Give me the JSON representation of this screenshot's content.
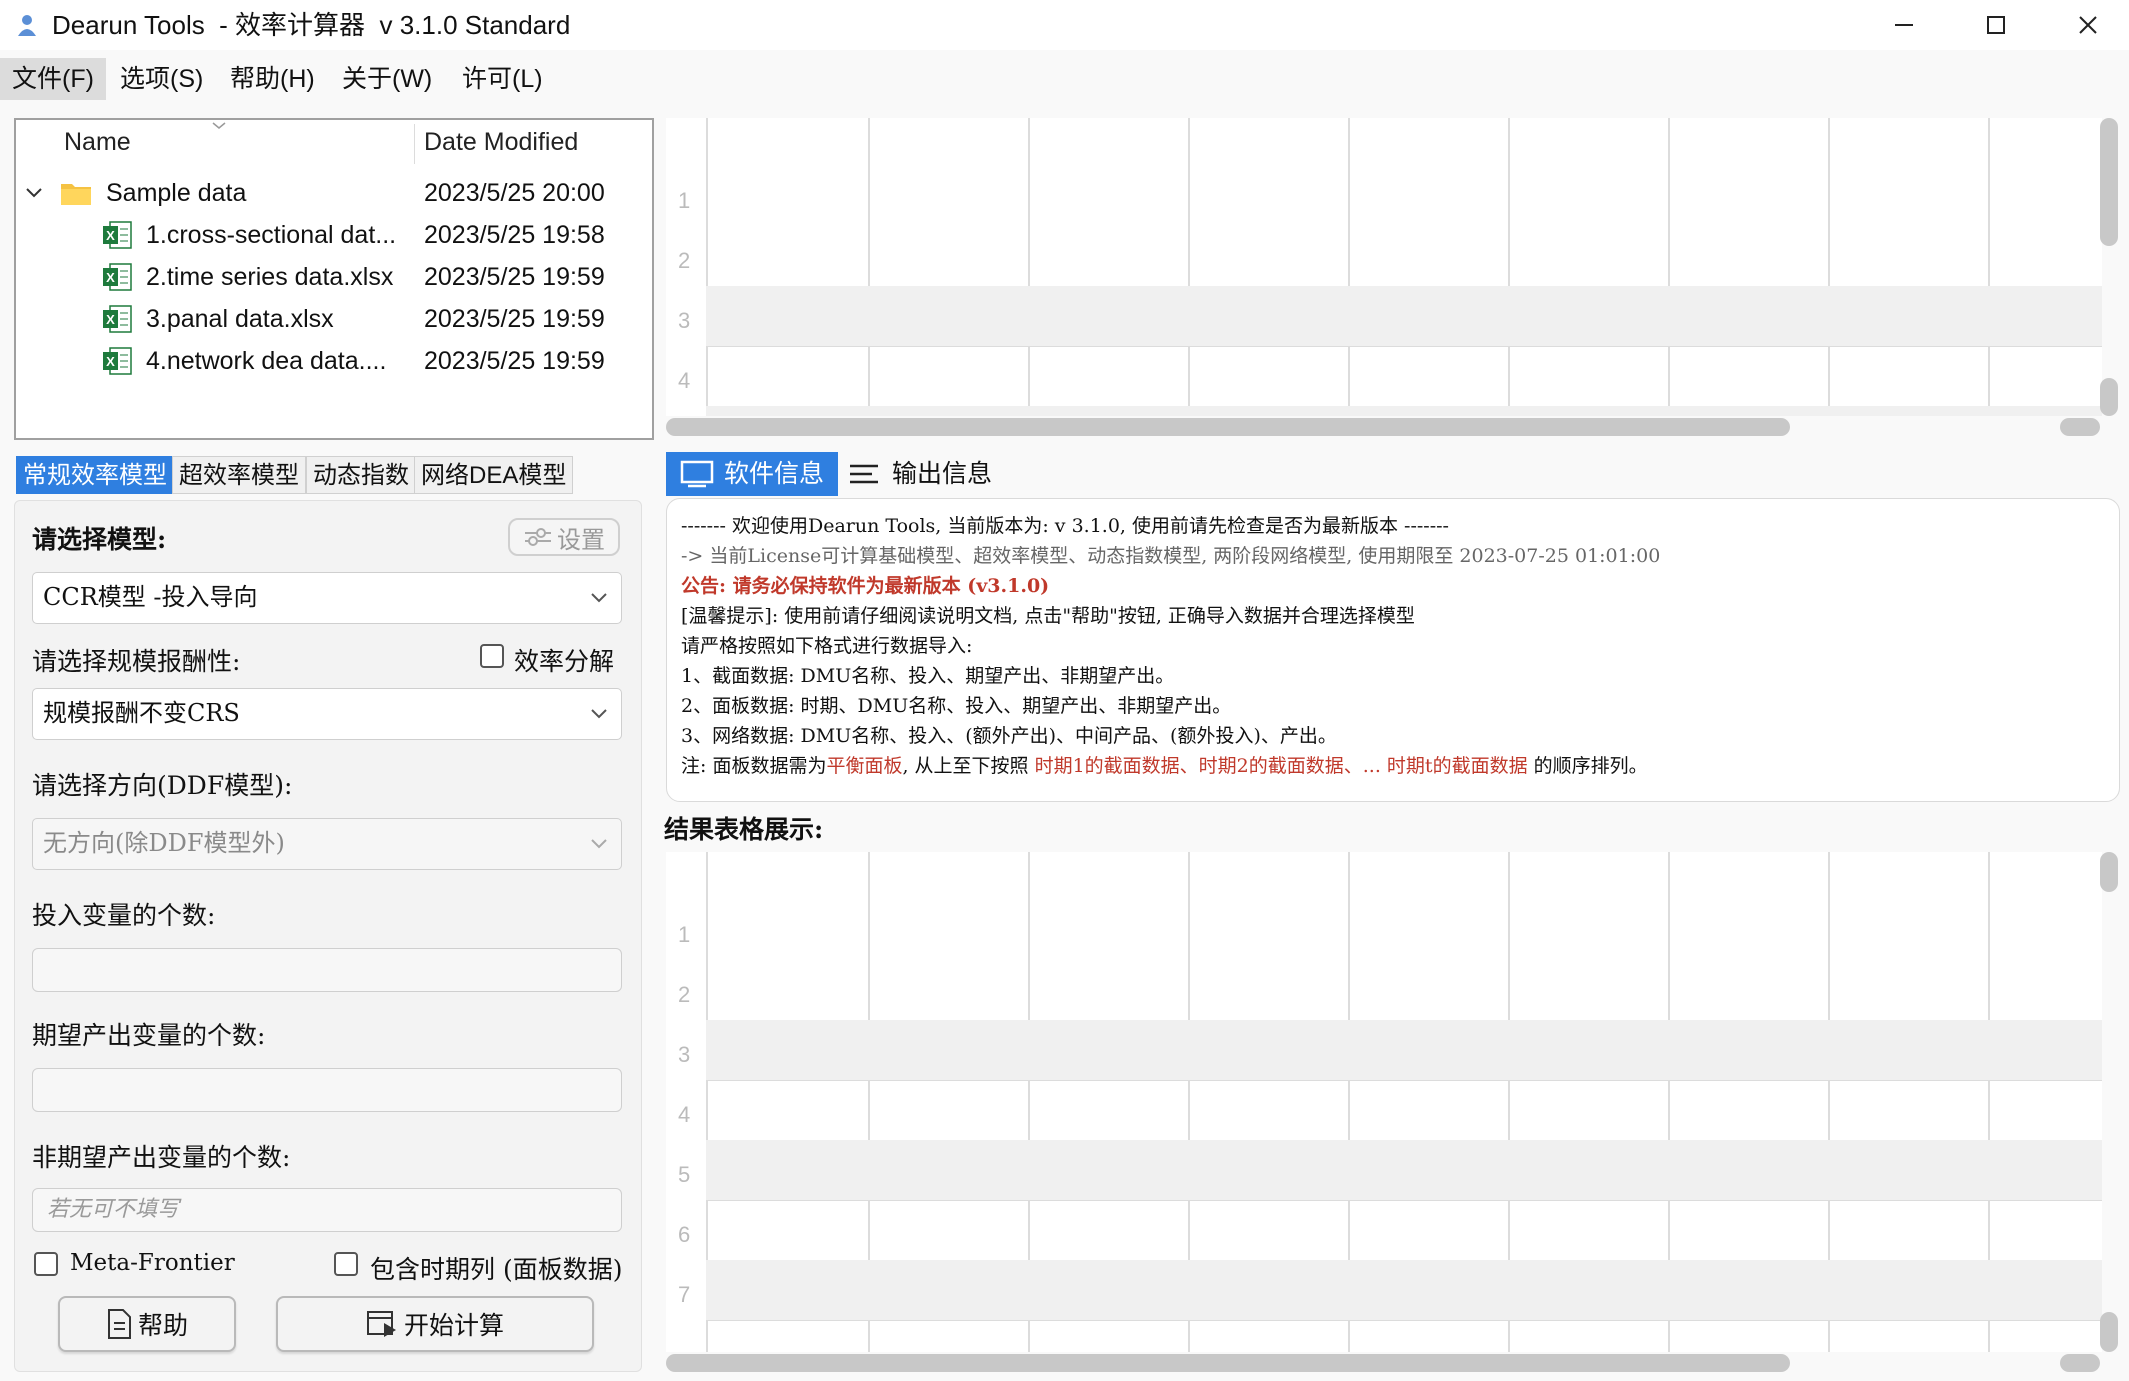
{
  "window": {
    "title": "Dearun Tools  - 效率计算器  v 3.1.0 Standard",
    "minimize_icon": "minimize-icon",
    "maximize_icon": "maximize-icon",
    "close_icon": "close-icon"
  },
  "menu": {
    "items": [
      "文件(F)",
      "选项(S)",
      "帮助(H)",
      "关于(W)",
      "许可(L)"
    ]
  },
  "file_tree": {
    "headers": {
      "name": "Name",
      "date": "Date Modified"
    },
    "folder": {
      "name": "Sample data",
      "date": "2023/5/25 20:00"
    },
    "files": [
      {
        "name": "1.cross-sectional dat...",
        "date": "2023/5/25 19:58"
      },
      {
        "name": "2.time series data.xlsx",
        "date": "2023/5/25 19:59"
      },
      {
        "name": "3.panal data.xlsx",
        "date": "2023/5/25 19:59"
      },
      {
        "name": "4.network dea data....",
        "date": "2023/5/25 19:59"
      }
    ]
  },
  "model_tabs": [
    "常规效率模型",
    "超效率模型",
    "动态指数",
    "网络DEA模型"
  ],
  "form": {
    "model_label": "请选择模型:",
    "settings_label": "设置",
    "model_value": "CCR模型 -投入导向",
    "returns_label": "请选择规模报酬性:",
    "decompose_label": "效率分解",
    "returns_value": "规模报酬不变CRS",
    "direction_label": "请选择方向(DDF模型):",
    "direction_value": "无方向(除DDF模型外)",
    "inputs_label": "投入变量的个数:",
    "desirable_label": "期望产出变量的个数:",
    "undesirable_label": "非期望产出变量的个数:",
    "undesirable_placeholder": "若无可不填写",
    "meta_frontier_label": "Meta-Frontier",
    "timeseries_label": "包含时期列 (面板数据)",
    "help_button": "帮助",
    "compute_button": "开始计算"
  },
  "top_grid": {
    "row_numbers": [
      "1",
      "2",
      "3",
      "4"
    ]
  },
  "info_tabs": [
    "软件信息",
    "输出信息"
  ],
  "info": {
    "line1": "------- 欢迎使用Dearun Tools, 当前版本为: v 3.1.0, 使用前请先检查是否为最新版本 -------",
    "line2": "-> 当前License可计算基础模型、超效率模型、动态指数模型, 两阶段网络模型, 使用期限至 2023-07-25 01:01:00",
    "line3": "公告: 请务必保持软件为最新版本 (v3.1.0)",
    "line4": "[温馨提示]: 使用前请仔细阅读说明文档, 点击\"帮助\"按钮, 正确导入数据并合理选择模型",
    "line5": "请严格按照如下格式进行数据导入:",
    "line6": "1、截面数据: DMU名称、投入、期望产出、非期望产出。",
    "line7": "2、面板数据: 时期、DMU名称、投入、期望产出、非期望产出。",
    "line8": "3、网络数据: DMU名称、投入、(额外产出)、中间产品、(额外投入)、产出。",
    "line9_a": "注: 面板数据需为",
    "line9_b": "平衡面板",
    "line9_c": ", 从上至下按照 ",
    "line9_d": "时期1的截面数据、时期2的截面数据、... 时期t的截面数据",
    "line9_e": " 的顺序排列。"
  },
  "results_label": "结果表格展示:",
  "bottom_grid": {
    "row_numbers": [
      "1",
      "2",
      "3",
      "4",
      "5",
      "6",
      "7"
    ]
  },
  "colors": {
    "accent": "#2f7fe0",
    "notice_red": "#c0392b"
  }
}
